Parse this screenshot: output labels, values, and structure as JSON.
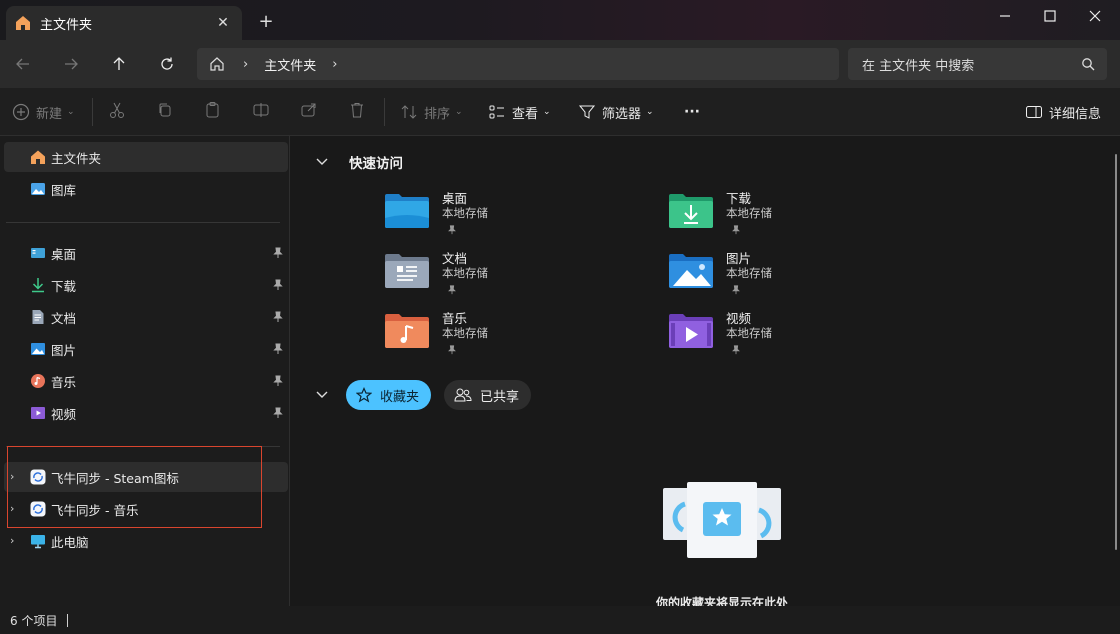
{
  "window": {
    "tab_title": "主文件夹",
    "tab_close": "✕",
    "new_tab": "+"
  },
  "address": {
    "crumb": "主文件夹",
    "search_placeholder": "在 主文件夹 中搜索"
  },
  "commandbar": {
    "new_label": "新建",
    "sort_label": "排序",
    "view_label": "查看",
    "filter_label": "筛选器",
    "more_label": "···",
    "details_label": "详细信息"
  },
  "sidebar": {
    "home": "主文件夹",
    "gallery": "图库",
    "pinned": [
      {
        "label": "桌面"
      },
      {
        "label": "下载"
      },
      {
        "label": "文档"
      },
      {
        "label": "图片"
      },
      {
        "label": "音乐"
      },
      {
        "label": "视频"
      }
    ],
    "sync1": "飞牛同步 - Steam图标",
    "sync2": "飞牛同步 - 音乐",
    "thispc": "此电脑"
  },
  "content": {
    "quick_access_title": "快速访问",
    "items": [
      {
        "name": "桌面",
        "sub": "本地存储"
      },
      {
        "name": "下载",
        "sub": "本地存储"
      },
      {
        "name": "文档",
        "sub": "本地存储"
      },
      {
        "name": "图片",
        "sub": "本地存储"
      },
      {
        "name": "音乐",
        "sub": "本地存储"
      },
      {
        "name": "视频",
        "sub": "本地存储"
      }
    ],
    "tab_favorites": "收藏夹",
    "tab_shared": "已共享",
    "empty_message": "你的收藏夹将显示在此处"
  },
  "status": {
    "count": "6 个项目"
  },
  "colors": {
    "accent": "#4cc2ff",
    "highlight_box": "#d9452e"
  }
}
